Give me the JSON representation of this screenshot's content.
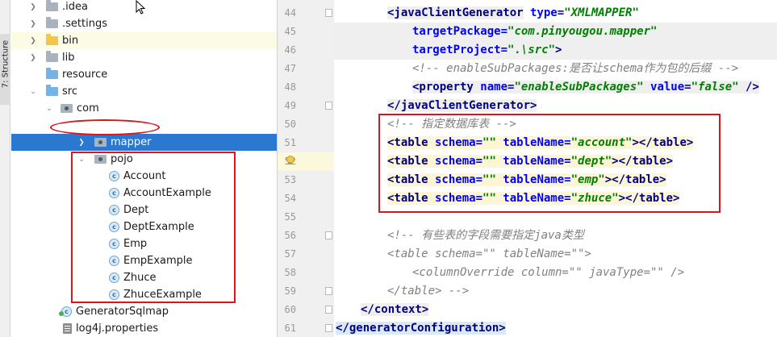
{
  "structure_panel": {
    "label": "7: Structure"
  },
  "tree": {
    "items": [
      {
        "label": ".idea",
        "icon": "folder-icon"
      },
      {
        "label": ".settings",
        "icon": "folder-icon"
      },
      {
        "label": "bin",
        "icon": "folder-icon"
      },
      {
        "label": "lib",
        "icon": "folder-icon"
      },
      {
        "label": "resource",
        "icon": "folder-icon"
      },
      {
        "label": "src",
        "icon": "source-folder-icon"
      },
      {
        "label": "com",
        "icon": "package-icon"
      },
      {
        "label": "mapper",
        "icon": "package-icon",
        "selected": true
      },
      {
        "label": "pojo",
        "icon": "package-icon"
      },
      {
        "label": "Account",
        "icon": "class-icon"
      },
      {
        "label": "AccountExample",
        "icon": "class-icon"
      },
      {
        "label": "Dept",
        "icon": "class-icon"
      },
      {
        "label": "DeptExample",
        "icon": "class-icon"
      },
      {
        "label": "Emp",
        "icon": "class-icon"
      },
      {
        "label": "EmpExample",
        "icon": "class-icon"
      },
      {
        "label": "Zhuce",
        "icon": "class-icon"
      },
      {
        "label": "ZhuceExample",
        "icon": "class-icon"
      },
      {
        "label": "GeneratorSqlmap",
        "icon": "class-icon"
      },
      {
        "label": "log4j.properties",
        "icon": "properties-icon"
      }
    ]
  },
  "editor": {
    "line_numbers": [
      "44",
      "45",
      "46",
      "47",
      "48",
      "49",
      "50",
      "51",
      "52",
      "53",
      "54",
      "55",
      "56",
      "57",
      "58",
      "59",
      "60",
      "61"
    ],
    "lines": {
      "l44": {
        "tag": "<javaClientGenerator",
        "a1": " type=",
        "v1": "\"XMLMAPPER\""
      },
      "l45": {
        "a1": "targetPackage=",
        "v1": "\"com.pinyougou.mapper\""
      },
      "l46": {
        "a1": "targetProject=",
        "v1": "\".\\src\"",
        "end": ">"
      },
      "l47": {
        "comment": "<!-- enableSubPackages:是否让schema作为包的后缀 -->"
      },
      "l48": {
        "tag": "<property",
        "a1": " name=",
        "v1": "\"enableSubPackages\"",
        "a2": " value=",
        "v2": "\"false\"",
        "end": " />"
      },
      "l49": {
        "tag": "</javaClientGenerator>"
      },
      "l50": {
        "comment": "<!-- 指定数据库表 -->"
      },
      "l51": {
        "tag": "<table",
        "a1": " schema=",
        "v1": "\"\"",
        "a2": " tableName=",
        "v2": "\"account\"",
        "end": "></table>"
      },
      "l52": {
        "tag": "<table",
        "a1": " schema=",
        "v1": "\"\"",
        "a2": " tableName=",
        "v2": "\"dept\"",
        "end": "></table>"
      },
      "l53": {
        "tag": "<table",
        "a1": " schema=",
        "v1": "\"\"",
        "a2": " tableName=",
        "v2": "\"emp\"",
        "end": "></table>"
      },
      "l54": {
        "tag": "<table",
        "a1": " schema=",
        "v1": "\"\"",
        "a2": " tableName=",
        "v2": "\"zhuce\"",
        "end": "></table>"
      },
      "l56": {
        "comment": "<!-- 有些表的字段需要指定java类型"
      },
      "l57": {
        "comment": "<table schema=\"\" tableName=\"\">"
      },
      "l58": {
        "comment": "<columnOverride column=\"\" javaType=\"\" />"
      },
      "l59": {
        "comment": "</table> -->"
      },
      "l60": {
        "tag": "</context>"
      },
      "l61": {
        "tag": "</generatorConfiguration>"
      }
    }
  },
  "colors": {
    "annotation": "#d9161b",
    "selection": "#2b78d0",
    "tag": "#000080",
    "attribute": "#0000ff",
    "value": "#008000",
    "comment": "#808080"
  }
}
